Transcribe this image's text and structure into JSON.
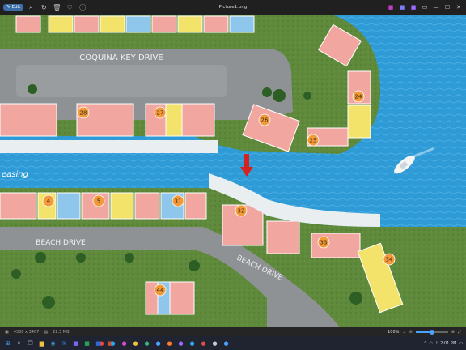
{
  "titlebar": {
    "edit_label": "Edit",
    "title": "Picture1.png",
    "icons": [
      "zoom-icon",
      "rotate-icon",
      "delete-icon",
      "heart-icon",
      "info-icon"
    ]
  },
  "map": {
    "street_top": "COQUINA KEY DRIVE",
    "street_bottom_left": "BEACH DRIVE",
    "street_bottom_right": "BEACH DRIVE",
    "leasing_label": "easing",
    "buildings": [
      {
        "num": "28"
      },
      {
        "num": "27"
      },
      {
        "num": "26"
      },
      {
        "num": "25"
      },
      {
        "num": "24"
      },
      {
        "num": "4"
      },
      {
        "num": "5"
      },
      {
        "num": "31"
      },
      {
        "num": "32"
      },
      {
        "num": "33"
      },
      {
        "num": "34"
      },
      {
        "num": "44"
      }
    ],
    "colors": {
      "water": "#2f9bd6",
      "land": "#5f8a3c",
      "road": "#8f9295",
      "pink": "#f1a6a0",
      "yellow": "#f3e36a",
      "blue": "#8ec6ec",
      "arrow": "#d2231e"
    }
  },
  "statusbar": {
    "dimensions": "4306 x 3407",
    "filesize": "21.3 MB",
    "zoom": "100%",
    "zoom_fraction": 0.5
  },
  "taskbar": {
    "time": "2:01 PM"
  }
}
